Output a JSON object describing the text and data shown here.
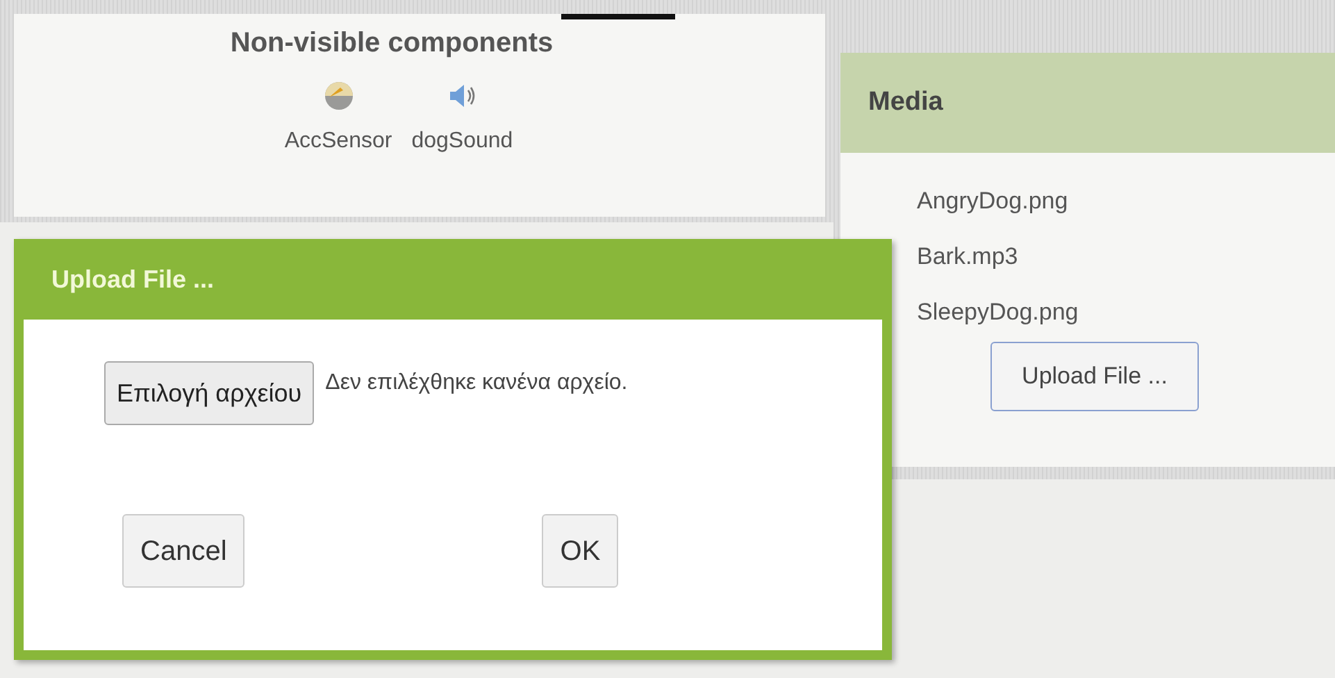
{
  "panel": {
    "title": "Non-visible components",
    "components": [
      {
        "name": "AccSensor",
        "kind": "sensor"
      },
      {
        "name": "dogSound",
        "kind": "sound"
      }
    ]
  },
  "media": {
    "title": "Media",
    "files": [
      "AngryDog.png",
      "Bark.mp3",
      "SleepyDog.png"
    ],
    "upload_button": "Upload File ..."
  },
  "dialog": {
    "title": "Upload File ...",
    "file_button": "Επιλογή αρχείου",
    "file_status": "Δεν επιλέχθηκε κανένα αρχείο.",
    "buttons": [
      "Cancel",
      "OK"
    ]
  }
}
